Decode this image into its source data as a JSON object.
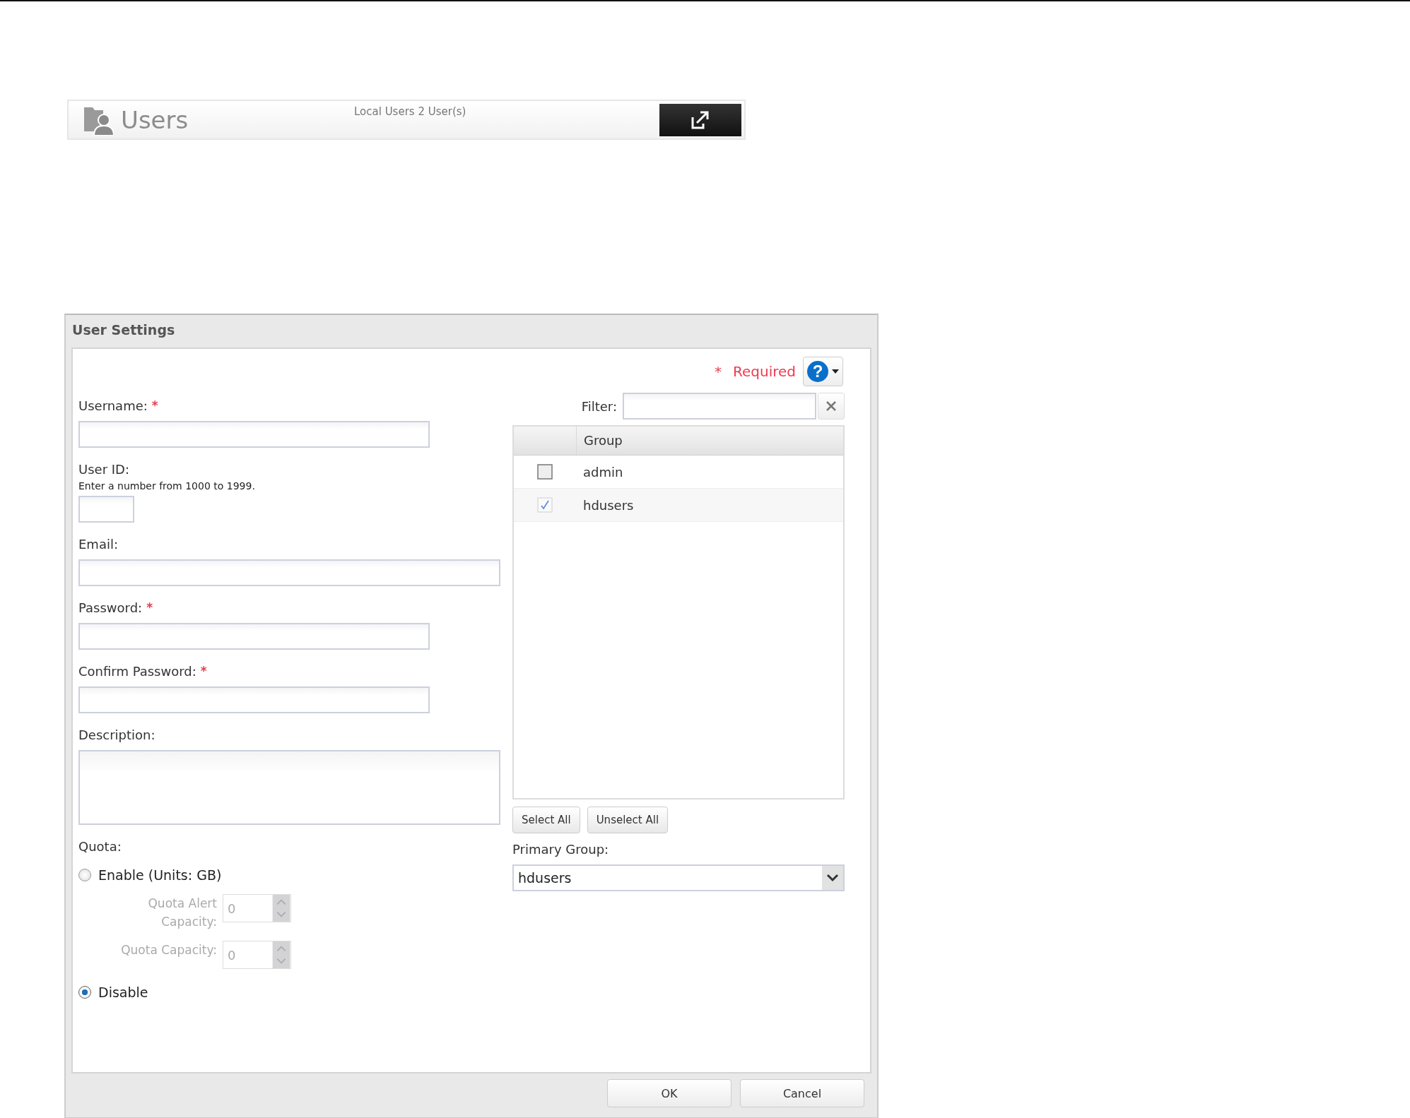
{
  "header": {
    "title": "Users",
    "summary": "Local Users 2 User(s)"
  },
  "dialog": {
    "title": "User Settings",
    "required_note": {
      "mark": "*",
      "text": "Required"
    },
    "help_button": {
      "symbol": "?"
    },
    "fields": [
      {
        "kind": "field",
        "label": "Username:",
        "required": true
      },
      {
        "kind": "short-field",
        "label": "User ID:",
        "required": false,
        "hint": "Enter a number from 1000 to 1999."
      },
      {
        "kind": "wide-field",
        "label": "Email:",
        "required": false
      },
      {
        "kind": "field",
        "label": "Password:",
        "required": true
      },
      {
        "kind": "field",
        "label": "Confirm Password:",
        "required": true
      },
      {
        "kind": "textarea",
        "label": "Description:",
        "required": false
      }
    ],
    "quota": {
      "label": "Quota:",
      "options": [
        {
          "label": "Enable (Units: GB)",
          "selected": false
        },
        {
          "label": "Disable",
          "selected": true
        }
      ],
      "settings": [
        {
          "label": "Quota Alert Capacity:",
          "value": "0",
          "disabled": true
        },
        {
          "label": "Quota Capacity:",
          "value": "0",
          "disabled": true
        }
      ]
    },
    "filter": {
      "label": "Filter:"
    },
    "groups": {
      "column": "Group",
      "rows": [
        {
          "name": "admin",
          "checked": false
        },
        {
          "name": "hdusers",
          "checked": true
        }
      ]
    },
    "group_buttons": [
      "Select All",
      "Unselect All"
    ],
    "primary_group": {
      "label": "Primary Group:",
      "value": "hdusers"
    },
    "buttons": [
      "OK",
      "Cancel"
    ]
  }
}
